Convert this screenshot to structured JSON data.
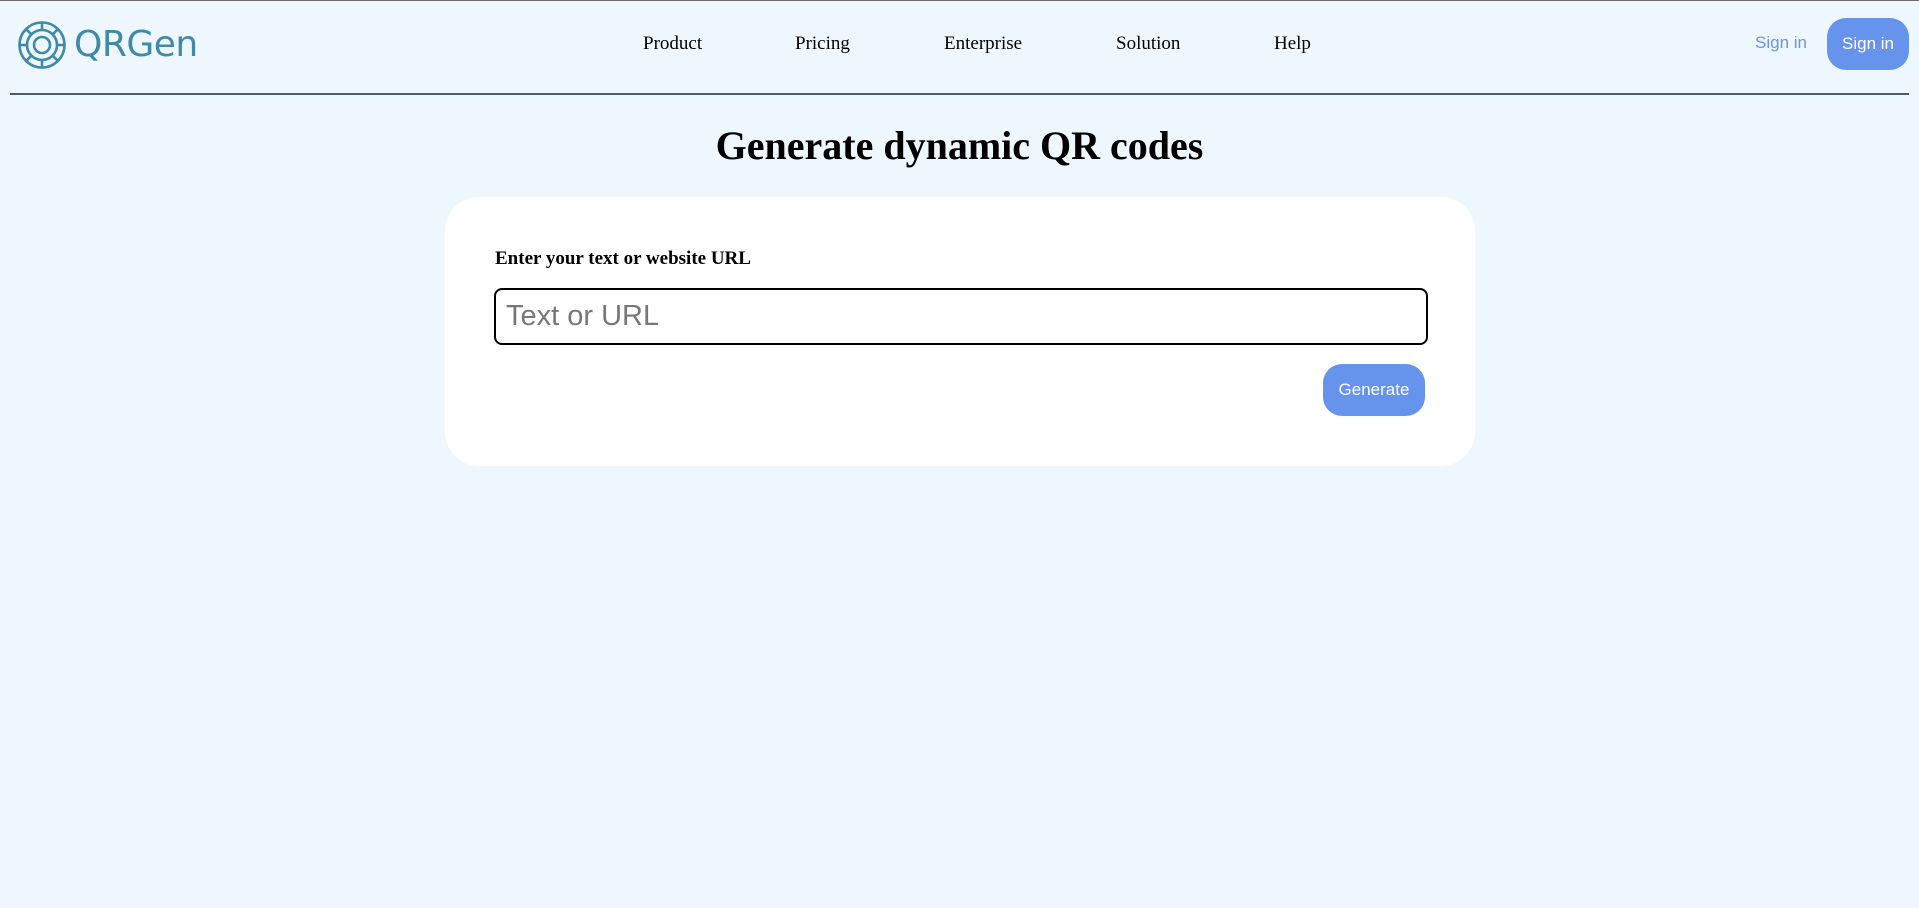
{
  "brand": {
    "name": "QRGen",
    "logo_icon": "wheel-logo-icon",
    "logo_color": "#3f8aa8"
  },
  "nav": {
    "items": [
      {
        "label": "Product"
      },
      {
        "label": "Pricing"
      },
      {
        "label": "Enterprise"
      },
      {
        "label": "Solution"
      },
      {
        "label": "Help"
      }
    ]
  },
  "auth": {
    "signin_link_label": "Sign in",
    "signin_button_label": "Sign in"
  },
  "main": {
    "title": "Generate dynamic QR codes",
    "form": {
      "label": "Enter your text or website URL",
      "input_value": "",
      "input_placeholder": "Text or URL",
      "submit_label": "Generate"
    }
  },
  "colors": {
    "background": "#eef7fe",
    "accent": "#6693ec",
    "link": "#6f92de",
    "card": "#ffffff"
  }
}
